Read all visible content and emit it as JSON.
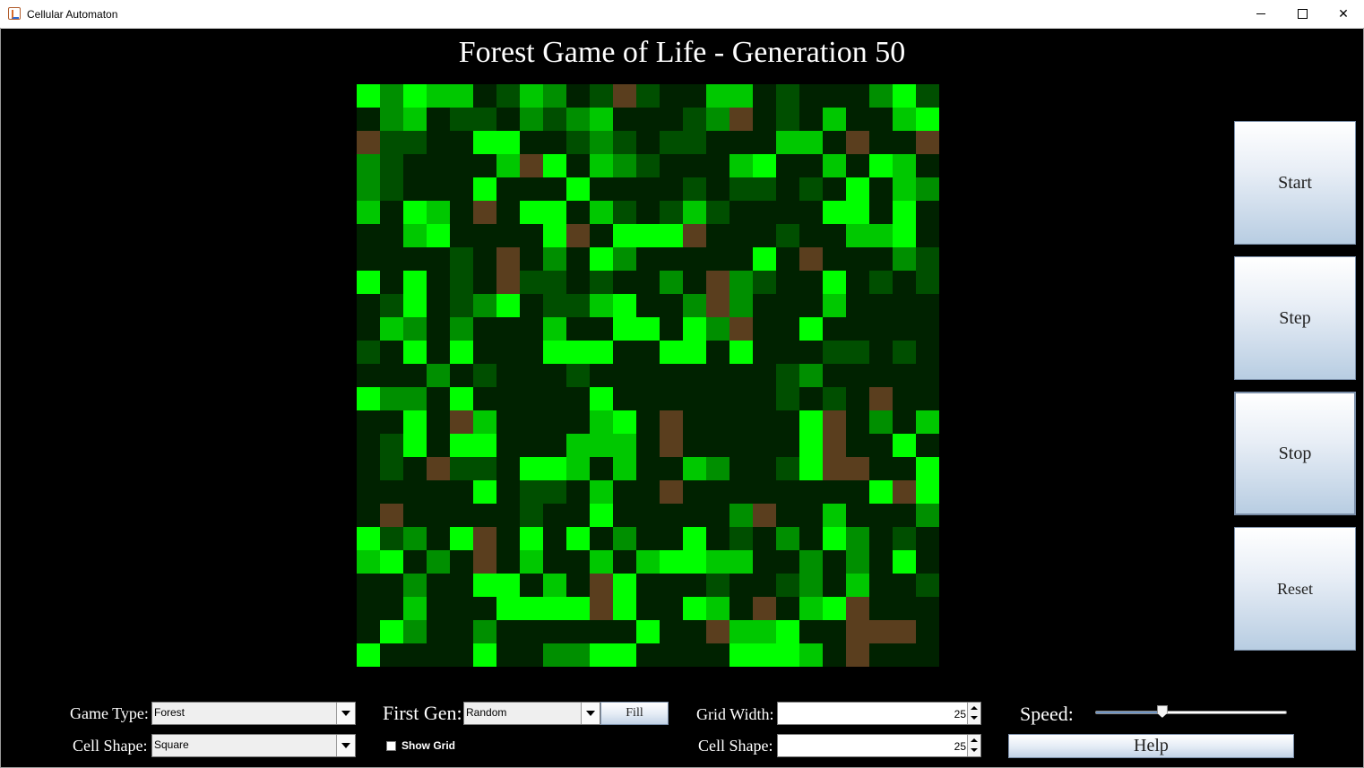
{
  "window": {
    "title": "Cellular Automaton",
    "minimize": "",
    "maximize": "",
    "close": "✕"
  },
  "main": {
    "title": "Forest Game of Life - Generation 50"
  },
  "grid": {
    "rows": 25,
    "cols": 25,
    "palette": {
      "0": "#002200",
      "1": "#004f00",
      "2": "#008f00",
      "3": "#00c800",
      "4": "#00ff00",
      "5": "#5a3e1e"
    },
    "cells": [
      "4243301320151003301000241",
      "0230110212300012501030034",
      "5110044001210110003305005",
      "2100003540321000340030430",
      "2100040004000010110104032",
      "3043050440310131000044040",
      "0034000045044450001003340",
      "0000105020420000040500021",
      "4040105110100205210040101",
      "0140124011340025200030000",
      "0320200030044042500400000",
      "1040400044400440400011010",
      "0002010001000000001200000",
      "4220400000400000001010500",
      "0040530000340500000450203",
      "0140440003330500000450040",
      "0105110443030032001455004",
      "0000040110300500000000454",
      "0500000100400000250030002",
      "4120450404020040102042010",
      "3402050300303443300202040",
      "0020044030540001001203001",
      "0030004444540043050345000",
      "0420020000004005334005550",
      "4000040022440000444305000"
    ]
  },
  "side_buttons": {
    "start": "Start",
    "step": "Step",
    "stop": "Stop",
    "reset": "Reset"
  },
  "controls": {
    "game_type_label": "Game Type:",
    "game_type_value": "Forest",
    "cell_shape_label": "Cell Shape:",
    "cell_shape_value": "Square",
    "first_gen_label": "First Gen:",
    "first_gen_value": "Random",
    "fill_label": "Fill",
    "show_grid_label": "Show Grid",
    "grid_width_label": "Grid Width:",
    "grid_width_value": "25",
    "cell_shape2_label": "Cell Shape:",
    "cell_shape2_value": "25",
    "speed_label": "Speed:",
    "speed_value": 0.35,
    "help_label": "Help"
  },
  "icons": {
    "app": "java-app-icon",
    "dropdown": "chevron-down-icon",
    "spinner": "spinner-arrows-icon"
  }
}
